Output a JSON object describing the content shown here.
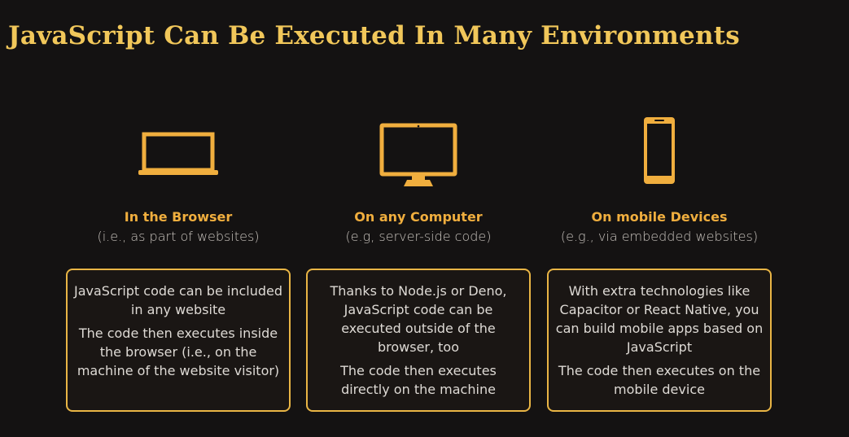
{
  "title": "JavaScript Can Be Executed In Many Environments",
  "colors": {
    "background": "#141212",
    "title": "#f1c75a",
    "accent": "#f0ae3e",
    "card_border": "#e9b545"
  },
  "environments": [
    {
      "icon": "laptop-icon",
      "heading": "In the Browser",
      "subheading": "(i.e., as part of websites)",
      "paragraphs": [
        "JavaScript code can be included in any website",
        "The code then executes inside the browser (i.e., on the machine of the website visitor)"
      ]
    },
    {
      "icon": "desktop-monitor-icon",
      "heading": "On any Computer",
      "subheading": "(e.g, server-side code)",
      "paragraphs": [
        "Thanks to Node.js or Deno, JavaScript code can be executed outside of the browser, too",
        "The code then executes directly on the machine"
      ]
    },
    {
      "icon": "smartphone-icon",
      "heading": "On mobile Devices",
      "subheading": "(e.g., via embedded websites)",
      "paragraphs": [
        "With extra technologies like Capacitor or React Native, you can build mobile apps based on JavaScript",
        "The code then executes on the mobile device"
      ]
    }
  ]
}
